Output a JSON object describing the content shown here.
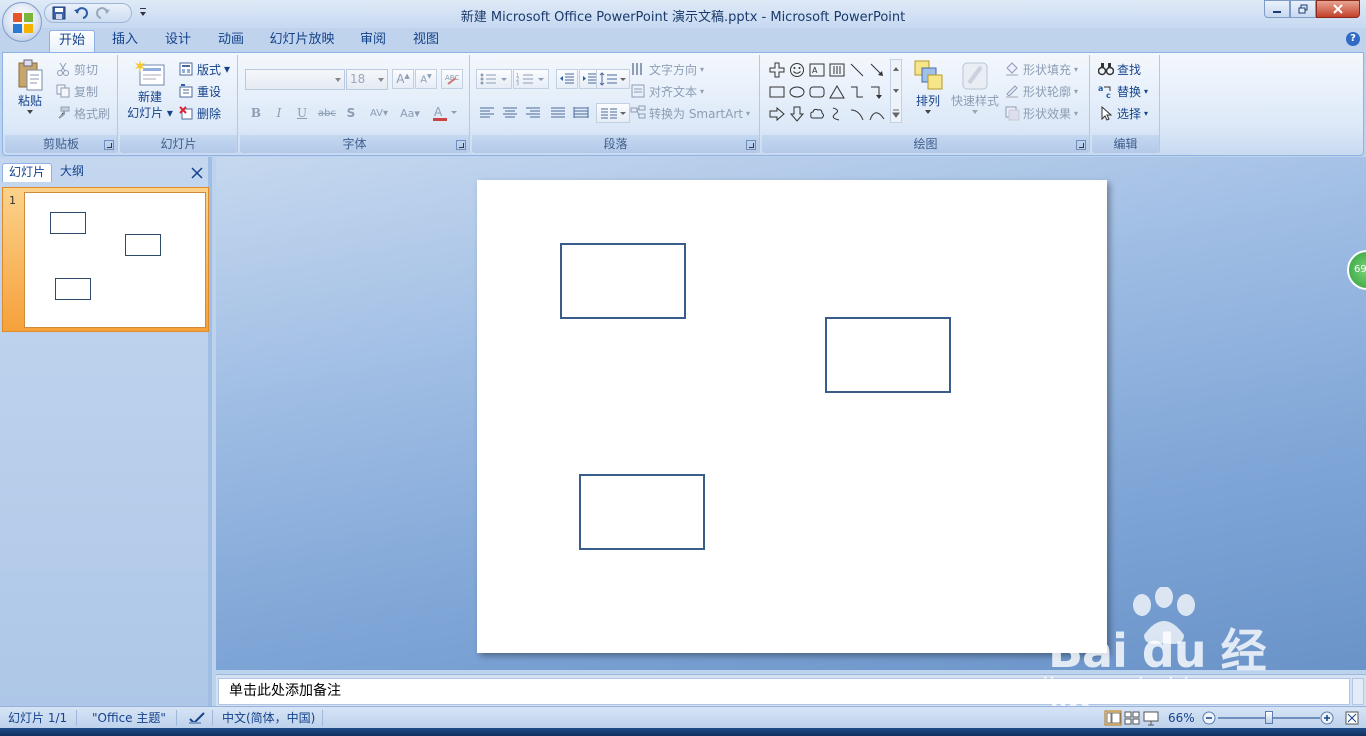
{
  "window": {
    "title": "新建 Microsoft Office PowerPoint 演示文稿.pptx - Microsoft PowerPoint"
  },
  "tabs": [
    {
      "label": "开始",
      "active": true
    },
    {
      "label": "插入"
    },
    {
      "label": "设计"
    },
    {
      "label": "动画"
    },
    {
      "label": "幻灯片放映"
    },
    {
      "label": "审阅"
    },
    {
      "label": "视图"
    }
  ],
  "ribbon": {
    "clipboard": {
      "label": "剪贴板",
      "paste": "粘贴",
      "cut": "剪切",
      "copy": "复制",
      "format_painter": "格式刷"
    },
    "slides": {
      "label": "幻灯片",
      "new_slide_line1": "新建",
      "new_slide_line2": "幻灯片",
      "layout": "版式",
      "reset": "重设",
      "delete": "删除"
    },
    "font": {
      "label": "字体",
      "font_name": "",
      "font_size": "18"
    },
    "paragraph": {
      "label": "段落",
      "text_direction": "文字方向",
      "align_text": "对齐文本",
      "smartart": "转换为 SmartArt"
    },
    "drawing": {
      "label": "绘图",
      "arrange": "排列",
      "quick_styles": "快速样式",
      "shape_fill": "形状填充",
      "shape_outline": "形状轮廓",
      "shape_effects": "形状效果"
    },
    "editing": {
      "label": "编辑",
      "find": "查找",
      "replace": "替换",
      "select": "选择"
    }
  },
  "left_pane": {
    "tab_slides": "幻灯片",
    "tab_outline": "大纲",
    "slide_number": "1"
  },
  "notes": {
    "placeholder": "单击此处添加备注"
  },
  "badge": "69",
  "watermark": {
    "logo": "Bai du 经验",
    "url": "jingyan.baidu.com"
  },
  "status": {
    "slide_info": "幻灯片 1/1",
    "theme": "\"Office 主题\"",
    "language": "中文(简体，中国)",
    "zoom": "66%",
    "zoom_fraction": 0.5
  },
  "colors": {
    "shape_outline": "#385d8a",
    "ribbon_text": "#15428b",
    "thumb_selected": "#f6a13b"
  }
}
